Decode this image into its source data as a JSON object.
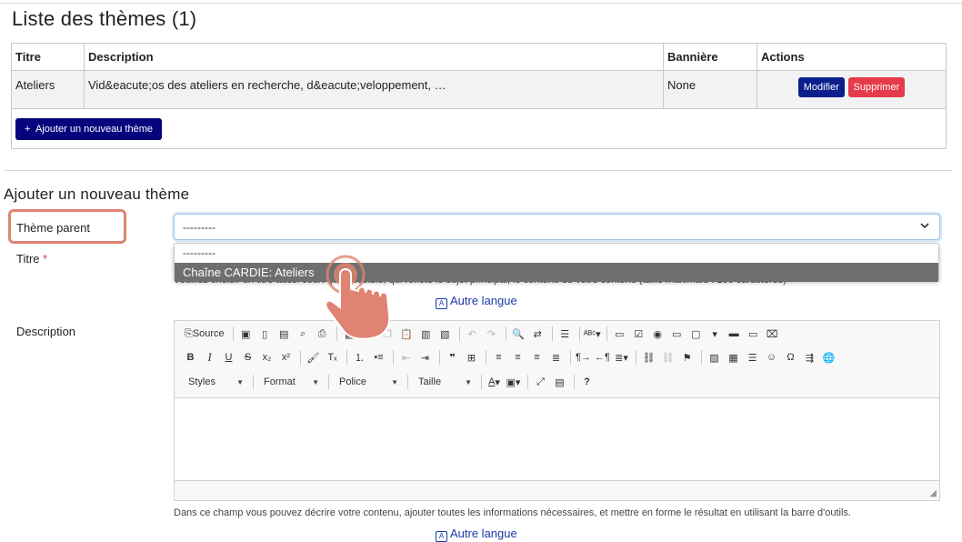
{
  "list": {
    "title": "Liste des thèmes (1)",
    "columns": [
      "Titre",
      "Description",
      "Bannière",
      "Actions"
    ],
    "rows": [
      {
        "titre": "Ateliers",
        "description": "Vid&eacute;os des ateliers en recherche, d&eacute;veloppement, …",
        "banniere": "None",
        "modifier": "Modifier",
        "supprimer": "Supprimer"
      }
    ],
    "add_button": "Ajouter un nouveau thème",
    "add_icon": "+"
  },
  "form": {
    "title": "Ajouter un nouveau thème",
    "theme_parent_label": "Thème parent",
    "theme_parent_value": "---------",
    "dropdown_options": [
      "---------",
      "Chaîne CARDIE: Ateliers"
    ],
    "titre_label": "Titre",
    "required_mark": "*",
    "titre_help": "Veuillez choisir un titre aussi court que possible, qui reflète le sujet principal, le contenu de votre contenu (taille maximale : 100 caractères)",
    "autre_langue": "Autre langue",
    "description_label": "Description",
    "description_help": "Dans ce champ vous pouvez décrire votre contenu, ajouter toutes les informations nécessaires, et mettre en forme le résultat en utilisant la barre d'outils."
  },
  "editor": {
    "source_label": "Source",
    "combos": [
      "Styles",
      "Format",
      "Police",
      "Taille"
    ]
  },
  "colors": {
    "primary_button": "#0a1e8c",
    "danger_button": "#e63b4a",
    "add_button": "#07057e",
    "highlight": "#e08373",
    "link": "#1a3aa8"
  }
}
